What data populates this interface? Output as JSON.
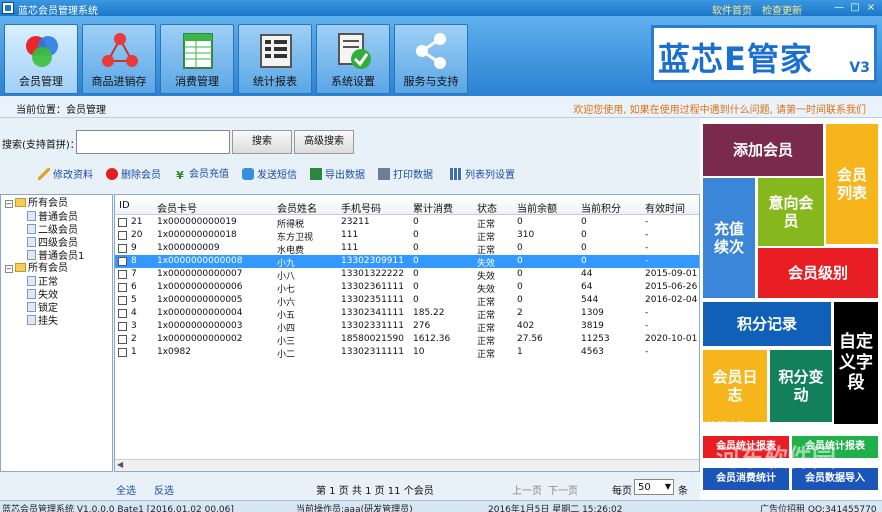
{
  "window": {
    "title": "蓝芯会员管理系统",
    "links": [
      "软件首页",
      "检查更新"
    ],
    "controls": [
      "—",
      "□",
      "×"
    ]
  },
  "toolbar": {
    "items": [
      {
        "label": "会员管理",
        "icon": "members-circles-icon"
      },
      {
        "label": "商品进销存",
        "icon": "inventory-nodes-icon"
      },
      {
        "label": "消费管理",
        "icon": "spreadsheet-icon"
      },
      {
        "label": "统计报表",
        "icon": "report-table-icon"
      },
      {
        "label": "系统设置",
        "icon": "settings-check-icon"
      },
      {
        "label": "服务与支持",
        "icon": "share-icon"
      }
    ]
  },
  "logo": {
    "text": "蓝芯E管家",
    "version": "V3"
  },
  "location": {
    "label": "当前位置：",
    "value": "会员管理",
    "welcome": "欢迎您使用, 如果在使用过程中遇到什么问题, 请第一时间联系我们"
  },
  "search": {
    "label": "搜索(支持首拼)：",
    "value": "",
    "search_btn": "搜索",
    "advanced_btn": "高级搜索"
  },
  "actions": [
    {
      "label": "修改资料",
      "icon": "edit-pencil-icon"
    },
    {
      "label": "删除会员",
      "icon": "delete-icon"
    },
    {
      "label": "会员充值",
      "icon": "yen-icon"
    },
    {
      "label": "发送短信",
      "icon": "sms-icon"
    },
    {
      "label": "导出数据",
      "icon": "export-excel-icon"
    },
    {
      "label": "打印数据",
      "icon": "printer-icon"
    },
    {
      "label": "列表列设置",
      "icon": "columns-icon"
    }
  ],
  "tree": {
    "groups": [
      {
        "label": "所有会员",
        "children": [
          "普通会员",
          "二级会员",
          "四级会员",
          "普通会员1"
        ]
      },
      {
        "label": "所有会员",
        "children": [
          "正常",
          "失效",
          "锁定",
          "挂失"
        ]
      }
    ]
  },
  "grid": {
    "columns": [
      "ID",
      "会员卡号",
      "会员姓名",
      "手机号码",
      "累计消费",
      "状态",
      "当前余额",
      "当前积分",
      "有效时间"
    ],
    "rows": [
      {
        "id": "21",
        "card": "1x000000000019",
        "name": "所得税",
        "phone": "23211",
        "total": "0",
        "status": "正常",
        "balance": "0",
        "points": "0",
        "expire": "-"
      },
      {
        "id": "20",
        "card": "1x000000000018",
        "name": "东方卫视",
        "phone": "111",
        "total": "0",
        "status": "正常",
        "balance": "310",
        "points": "0",
        "expire": "-"
      },
      {
        "id": "9",
        "card": "1x000000009",
        "name": "水电费",
        "phone": "111",
        "total": "0",
        "status": "正常",
        "balance": "0",
        "points": "0",
        "expire": "-"
      },
      {
        "id": "8",
        "card": "1x0000000000008",
        "name": "小九",
        "phone": "13302309911",
        "total": "0",
        "status": "失效",
        "balance": "0",
        "points": "0",
        "expire": "-"
      },
      {
        "id": "7",
        "card": "1x0000000000007",
        "name": "小八",
        "phone": "13301322222",
        "total": "0",
        "status": "失效",
        "balance": "0",
        "points": "44",
        "expire": "2015-09-01"
      },
      {
        "id": "6",
        "card": "1x0000000000006",
        "name": "小七",
        "phone": "13302361111",
        "total": "0",
        "status": "失效",
        "balance": "0",
        "points": "64",
        "expire": "2015-06-26"
      },
      {
        "id": "5",
        "card": "1x0000000000005",
        "name": "小六",
        "phone": "13302351111",
        "total": "0",
        "status": "正常",
        "balance": "0",
        "points": "544",
        "expire": "2016-02-04"
      },
      {
        "id": "4",
        "card": "1x0000000000004",
        "name": "小五",
        "phone": "13302341111",
        "total": "185.22",
        "status": "正常",
        "balance": "2",
        "points": "1309",
        "expire": "-"
      },
      {
        "id": "3",
        "card": "1x0000000000003",
        "name": "小四",
        "phone": "13302331111",
        "total": "276",
        "status": "正常",
        "balance": "402",
        "points": "3819",
        "expire": "-"
      },
      {
        "id": "2",
        "card": "1x0000000000002",
        "name": "小三",
        "phone": "18580021590",
        "total": "1612.36",
        "status": "正常",
        "balance": "27.56",
        "points": "11253",
        "expire": "2020-10-01"
      },
      {
        "id": "1",
        "card": "1x0982",
        "name": "小二",
        "phone": "13302311111",
        "total": "10",
        "status": "正常",
        "balance": "1",
        "points": "4563",
        "expire": "-"
      }
    ]
  },
  "bottom": {
    "select_all": "全选",
    "invert": "反选",
    "page_info": "第 1 页  共 1 页  11 个会员",
    "prev": "上一页",
    "next": "下一页",
    "per_page_label": "每页",
    "per_page_value": "50",
    "per_page_suffix": "条"
  },
  "status_bar": {
    "version": "蓝芯会员管理系统 V1.0.0.0 Bate1 [2016.01.02  00.06]",
    "operator": "当前操作员:aaa(研发管理员)",
    "datetime": "2016年1月5日   星期二    15:26:02",
    "ad": "广告位招租 QQ:341455770"
  },
  "panel": {
    "tiles": [
      {
        "label": "添加会员",
        "color": "#7a2a4a"
      },
      {
        "label": "会员列表",
        "color": "#f7b51c"
      },
      {
        "label": "充值续次",
        "color": "#3b86d8"
      },
      {
        "label": "意向会员",
        "color": "#86b81e"
      },
      {
        "label": "会员级别",
        "color": "#e81e24"
      },
      {
        "label": "积分记录",
        "color": "#1060b8"
      },
      {
        "label": "自定义字段",
        "color": "#000000"
      },
      {
        "label": "会员日志",
        "color": "#f7b51c"
      },
      {
        "label": "积分变动",
        "color": "#12805a"
      }
    ],
    "section_label": "快捷功能",
    "bottom_tiles": [
      {
        "label": "会员统计报表",
        "color": "#e81e24"
      },
      {
        "label": "会员统计报表",
        "color": "#1fb04a"
      },
      {
        "label": "会员消费统计",
        "color": "#1c55b8"
      },
      {
        "label": "会员数据导入",
        "color": "#1c55b8"
      }
    ]
  },
  "watermark": "河东软件园",
  "colors": {
    "accent": "#1a6fd0",
    "selected_row": "#3399ff",
    "welcome": "#e07010"
  }
}
